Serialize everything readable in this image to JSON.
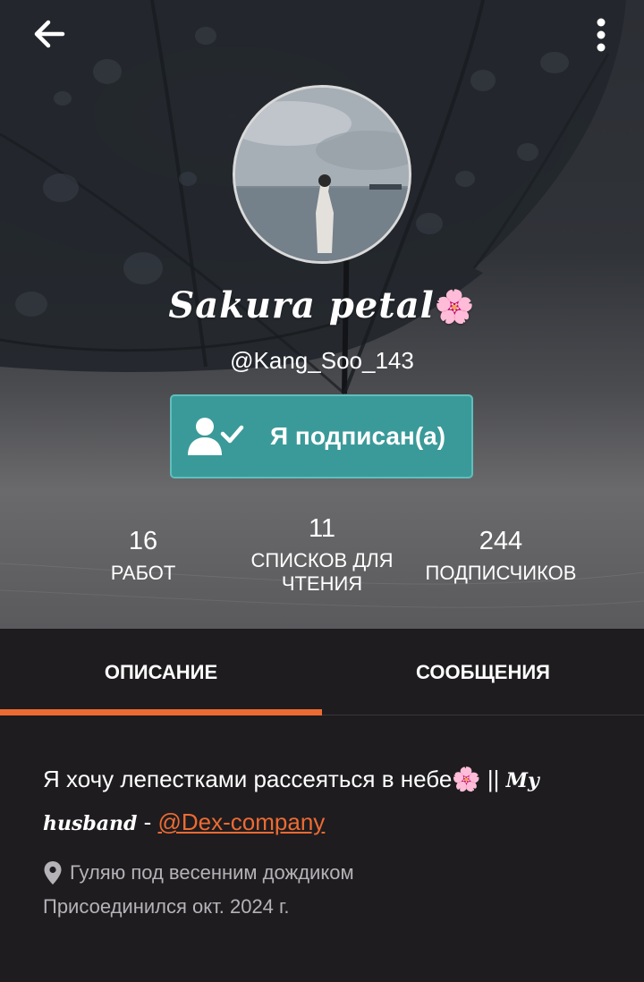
{
  "profile": {
    "display_name": "Sakura petal",
    "display_name_emoji": "🌸",
    "username": "@Kang_Soo_143",
    "avatar_alt": "avatar"
  },
  "follow_button": {
    "label": "Я подписан(а)",
    "icon": "user-check-icon"
  },
  "stats": {
    "works": {
      "value": "16",
      "label": "РАБОТ"
    },
    "reading_lists": {
      "value": "11",
      "label_line1": "СПИСКОВ ДЛЯ",
      "label_line2": "ЧТЕНИЯ"
    },
    "followers": {
      "value": "244",
      "label": "ПОДПИСЧИКОВ"
    }
  },
  "tabs": [
    {
      "label": "ОПИСАНИЕ",
      "active": true
    },
    {
      "label": "СООБЩЕНИЯ",
      "active": false
    }
  ],
  "about": {
    "bio_text": "Я хочу лепестками рассеяться в небе",
    "bio_emoji": "🌸",
    "bio_separator": " || ",
    "bio_fancy_1": "My",
    "bio_fancy_2": "husband",
    "bio_dash": " - ",
    "bio_link": "@Dex-company",
    "location": "Гуляю под весенним дождиком",
    "joined": "Присоединился окт. 2024 г."
  },
  "colors": {
    "accent": "#ec6b33",
    "follow_button_bg": "#3a9a99",
    "background": "#1e1c1f",
    "muted_text": "#b5b3b7"
  }
}
